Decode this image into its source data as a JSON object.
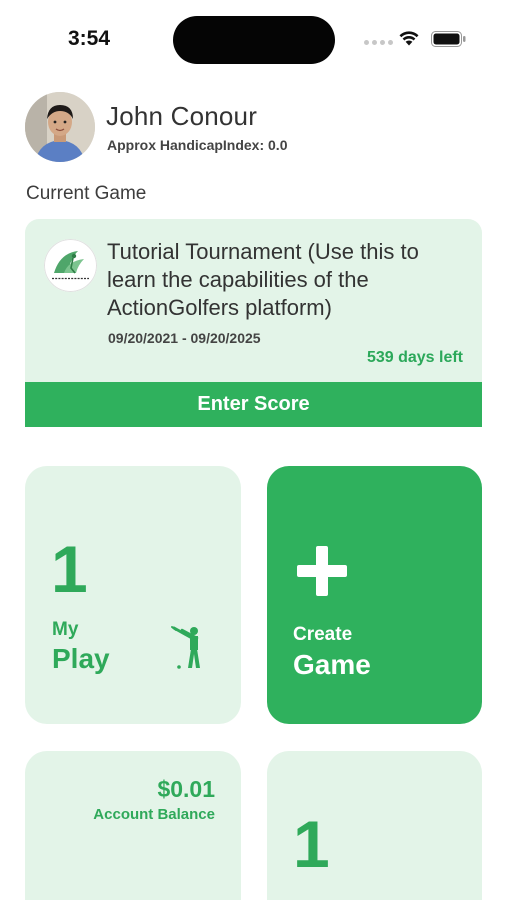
{
  "status_bar": {
    "time": "3:54",
    "icons": [
      "signal-dots-icon",
      "wifi-icon",
      "battery-icon"
    ]
  },
  "profile": {
    "name": "John Conour",
    "handicap": "Approx HandicapIndex: 0.0",
    "avatar": "user-avatar-photo"
  },
  "current_game": {
    "section_title": "Current Game",
    "logo": "actiongolfers-logo",
    "title": "Tutorial Tournament (Use this to learn the capabilities of the ActionGolfers platform)",
    "dates": "09/20/2021 - 09/20/2025",
    "days_left": "539 days left",
    "enter_score_label": "Enter Score"
  },
  "tiles": {
    "my_play": {
      "count": "1",
      "label_line1": "My",
      "label_line2": "Play",
      "icon": "golfer-icon"
    },
    "create_game": {
      "icon": "plus-icon",
      "label_line1": "Create",
      "label_line2": "Game"
    },
    "account_balance": {
      "amount": "$0.01",
      "label": "Account Balance"
    },
    "fourth_tile": {
      "count": "1"
    }
  },
  "colors": {
    "accent_green": "#2fb15d",
    "light_green": "#e3f4e8",
    "text_green": "#2fa95a"
  }
}
